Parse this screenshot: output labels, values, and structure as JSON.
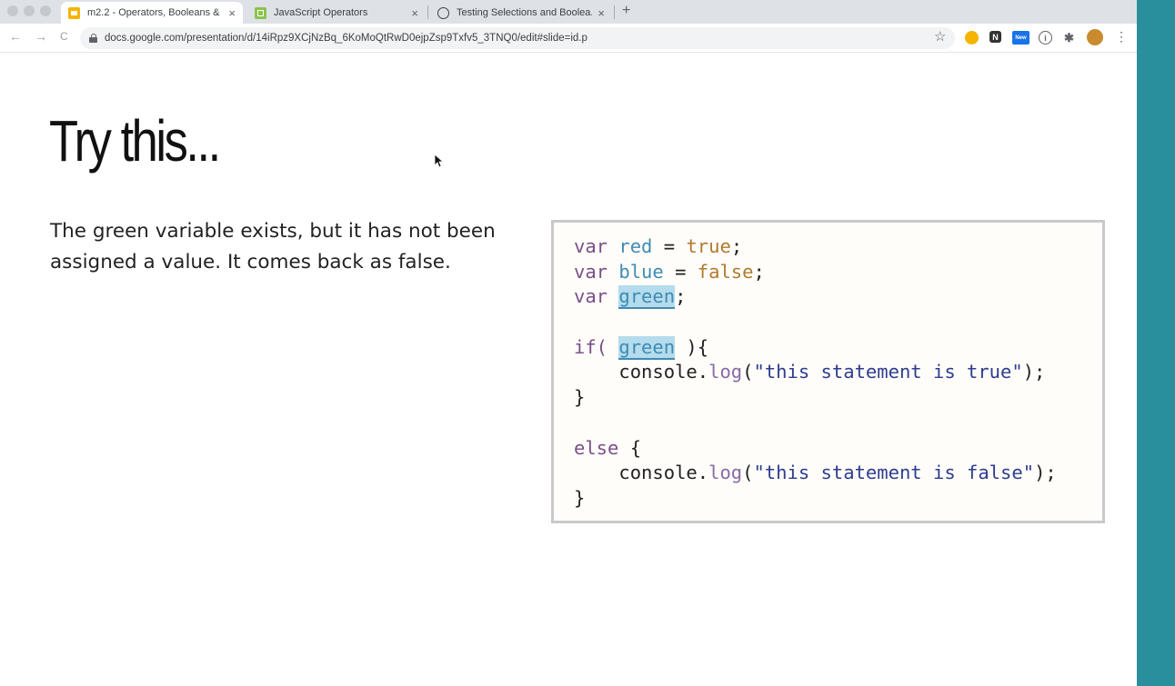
{
  "browser": {
    "tabs": [
      {
        "title": "m2.2 - Operators, Booleans & ...",
        "active": true,
        "favicon": "slides-icon",
        "favicon_color": "#f4b400"
      },
      {
        "title": "JavaScript Operators",
        "active": false,
        "favicon": "sheet-icon",
        "favicon_color": "#8bc34a"
      },
      {
        "title": "Testing Selections and Boolea...",
        "active": false,
        "favicon": "globe-icon",
        "favicon_color": "#3c4043"
      }
    ],
    "new_tab": "+",
    "close_glyph": "×",
    "url": "docs.google.com/presentation/d/14iRpz9XCjNzBq_6KoMoQtRwD0ejpZsp9Txfv5_3TNQ0/edit#slide=id.p",
    "back": "←",
    "forward": "→",
    "reload": "C",
    "star": "☆",
    "extensions": [
      {
        "name": "emoji-extension-icon",
        "color": "#f4b400",
        "label": ""
      },
      {
        "name": "notion-extension-icon",
        "color": "#333333",
        "label": "N"
      },
      {
        "name": "new-extension-icon",
        "color": "#1a73e8",
        "label": "New"
      },
      {
        "name": "info-extension-icon",
        "color": "#5f6368",
        "label": "i"
      },
      {
        "name": "puzzle-extension-icon",
        "color": "#5f6368",
        "label": "✱"
      },
      {
        "name": "profile-avatar-icon",
        "color": "#c98b2e",
        "label": ""
      }
    ],
    "menu": "⋮"
  },
  "slide": {
    "title": "Try this...",
    "body": "The green variable exists, but it has not been assigned a value. It comes back as false.",
    "code": {
      "line1": {
        "kw": "var",
        "id": "red",
        "op": " = ",
        "lit": "true",
        "end": ";"
      },
      "line2": {
        "kw": "var",
        "id": "blue",
        "op": " = ",
        "lit": "false",
        "end": ";"
      },
      "line3": {
        "kw": "var",
        "id": "green",
        "end": ";"
      },
      "line5": {
        "kw": "if(",
        "id": "green",
        "end": " ){"
      },
      "line6": {
        "indent": "    ",
        "obj": "console.",
        "fn": "log",
        "open": "(",
        "str": "\"this statement is true\"",
        "close": ");"
      },
      "line7": {
        "text": "}"
      },
      "line9": {
        "kw": "else",
        "end": " {"
      },
      "line10": {
        "indent": "    ",
        "obj": "console.",
        "fn": "log",
        "open": "(",
        "str": "\"this statement is false\"",
        "close": ");"
      },
      "line11": {
        "text": "}"
      }
    }
  }
}
